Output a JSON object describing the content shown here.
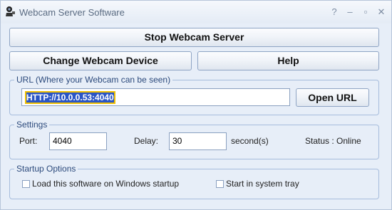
{
  "window": {
    "title": "Webcam Server Software",
    "minimize_glyph": "–",
    "maximize_glyph": "▫",
    "close_glyph": "✕"
  },
  "buttons": {
    "stop": "Stop Webcam Server",
    "change_device": "Change Webcam Device",
    "help": "Help",
    "open_url": "Open URL"
  },
  "url_group": {
    "legend": "URL (Where your Webcam can be seen)",
    "value": "HTTP://10.0.0.53:4040"
  },
  "settings": {
    "legend": "Settings",
    "port_label": "Port:",
    "port_value": "4040",
    "delay_label": "Delay:",
    "delay_value": "30",
    "delay_unit": "second(s)",
    "status": "Status : Online"
  },
  "startup": {
    "legend": "Startup Options",
    "load_label": "Load this software on Windows startup",
    "load_checked": false,
    "tray_label": "Start in system tray",
    "tray_checked": false
  }
}
